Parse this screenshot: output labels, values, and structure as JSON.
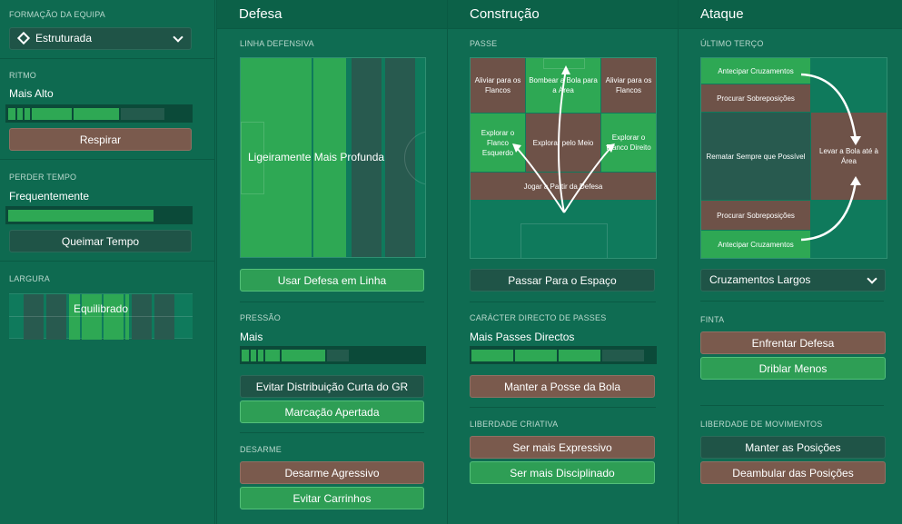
{
  "left": {
    "formacao_label": "FORMAÇÃO DA EQUIPA",
    "formacao_value": "Estruturada",
    "ritmo_label": "RITMO",
    "ritmo_value": "Mais Alto",
    "ritmo_button": "Respirar",
    "perder_tempo_label": "PERDER TEMPO",
    "perder_tempo_value": "Frequentemente",
    "perder_tempo_button": "Queimar Tempo",
    "largura_label": "LARGURA",
    "largura_value": "Equilibrado"
  },
  "defesa": {
    "title": "Defesa",
    "linha_label": "LINHA DEFENSIVA",
    "linha_value": "Ligeiramente Mais Profunda",
    "linha_button": "Usar Defesa em Linha",
    "pressao_label": "PRESSÃO",
    "pressao_value": "Mais",
    "pressao_btn1": "Evitar Distribuição Curta do GR",
    "pressao_btn2": "Marcação Apertada",
    "desarme_label": "DESARME",
    "desarme_btn1": "Desarme Agressivo",
    "desarme_btn2": "Evitar Carrinhos"
  },
  "construcao": {
    "title": "Construção",
    "passe_label": "PASSE",
    "zones": {
      "aliviar_esq": "Aliviar para os Flancos",
      "bombear": "Bombear a Bola para a Área",
      "aliviar_dir": "Aliviar para os Flancos",
      "explorar_esq": "Explorar o Flanco Esquerdo",
      "explorar_meio": "Explorar pelo Meio",
      "explorar_dir": "Explorar o Flanco Direito",
      "jogar_defesa": "Jogar a Partir da Defesa"
    },
    "passe_button": "Passar Para o Espaço",
    "directo_label": "CARÁCTER DIRECTO DE PASSES",
    "directo_value": "Mais Passes Directos",
    "directo_button": "Manter a Posse da Bola",
    "liberdade_label": "LIBERDADE CRIATIVA",
    "liberdade_btn1": "Ser mais Expressivo",
    "liberdade_btn2": "Ser mais Disciplinado"
  },
  "ataque": {
    "title": "Ataque",
    "terco_label": "ÚLTIMO TERÇO",
    "zones": {
      "antecipar_top": "Antecipar Cruzamentos",
      "procurar_top": "Procurar Sobreposições",
      "rematar": "Rematar Sempre que Possível",
      "levar_area": "Levar a Bola até à Área",
      "procurar_bot": "Procurar Sobreposições",
      "antecipar_bot": "Antecipar Cruzamentos"
    },
    "cruzamentos_value": "Cruzamentos Largos",
    "finta_label": "FINTA",
    "finta_btn1": "Enfrentar Defesa",
    "finta_btn2": "Driblar Menos",
    "movimentos_label": "LIBERDADE DE MOVIMENTOS",
    "movimentos_btn1": "Manter as Posições",
    "movimentos_btn2": "Deambular das Posições"
  }
}
